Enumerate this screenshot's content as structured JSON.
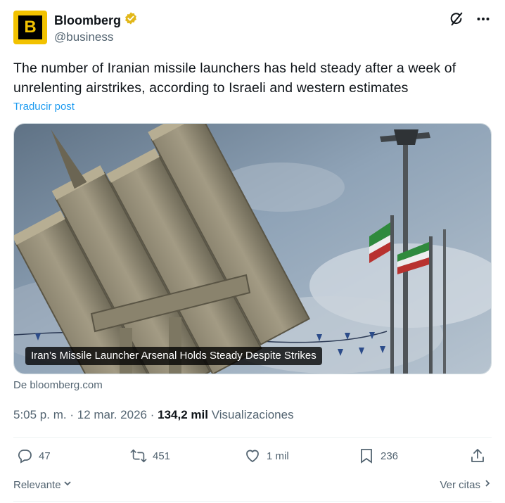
{
  "author": {
    "avatar_letter": "B",
    "display_name": "Bloomberg",
    "handle": "@business",
    "verified": true,
    "verified_badge_color": "#e2b719",
    "avatar_bg": "#f2c200"
  },
  "post": {
    "text": "The number of Iranian missile launchers has held steady after a week of unrelenting airstrikes, according to Israeli and western estimates",
    "translate_label": "Traducir post",
    "media_caption": "Iran’s Missile Launcher Arsenal Holds Steady Despite Strikes",
    "source_label": "De bloomberg.com"
  },
  "meta": {
    "time": "5:05 p. m.",
    "separator": "·",
    "date": "12 mar. 2026",
    "views_count": "134,2 mil",
    "views_label": "Visualizaciones"
  },
  "actions": {
    "replies": "47",
    "reposts": "451",
    "likes": "1 mil",
    "bookmarks": "236"
  },
  "footer": {
    "sort_label": "Relevante",
    "quotes_label": "Ver citas"
  },
  "icons": {
    "grok": "grok-icon",
    "more": "more-icon",
    "reply": "reply-icon",
    "repost": "repost-icon",
    "like": "heart-icon",
    "bookmark": "bookmark-icon",
    "share": "share-icon"
  },
  "colors": {
    "link": "#1d9bf0",
    "muted": "#536471",
    "text": "#0f1419"
  }
}
